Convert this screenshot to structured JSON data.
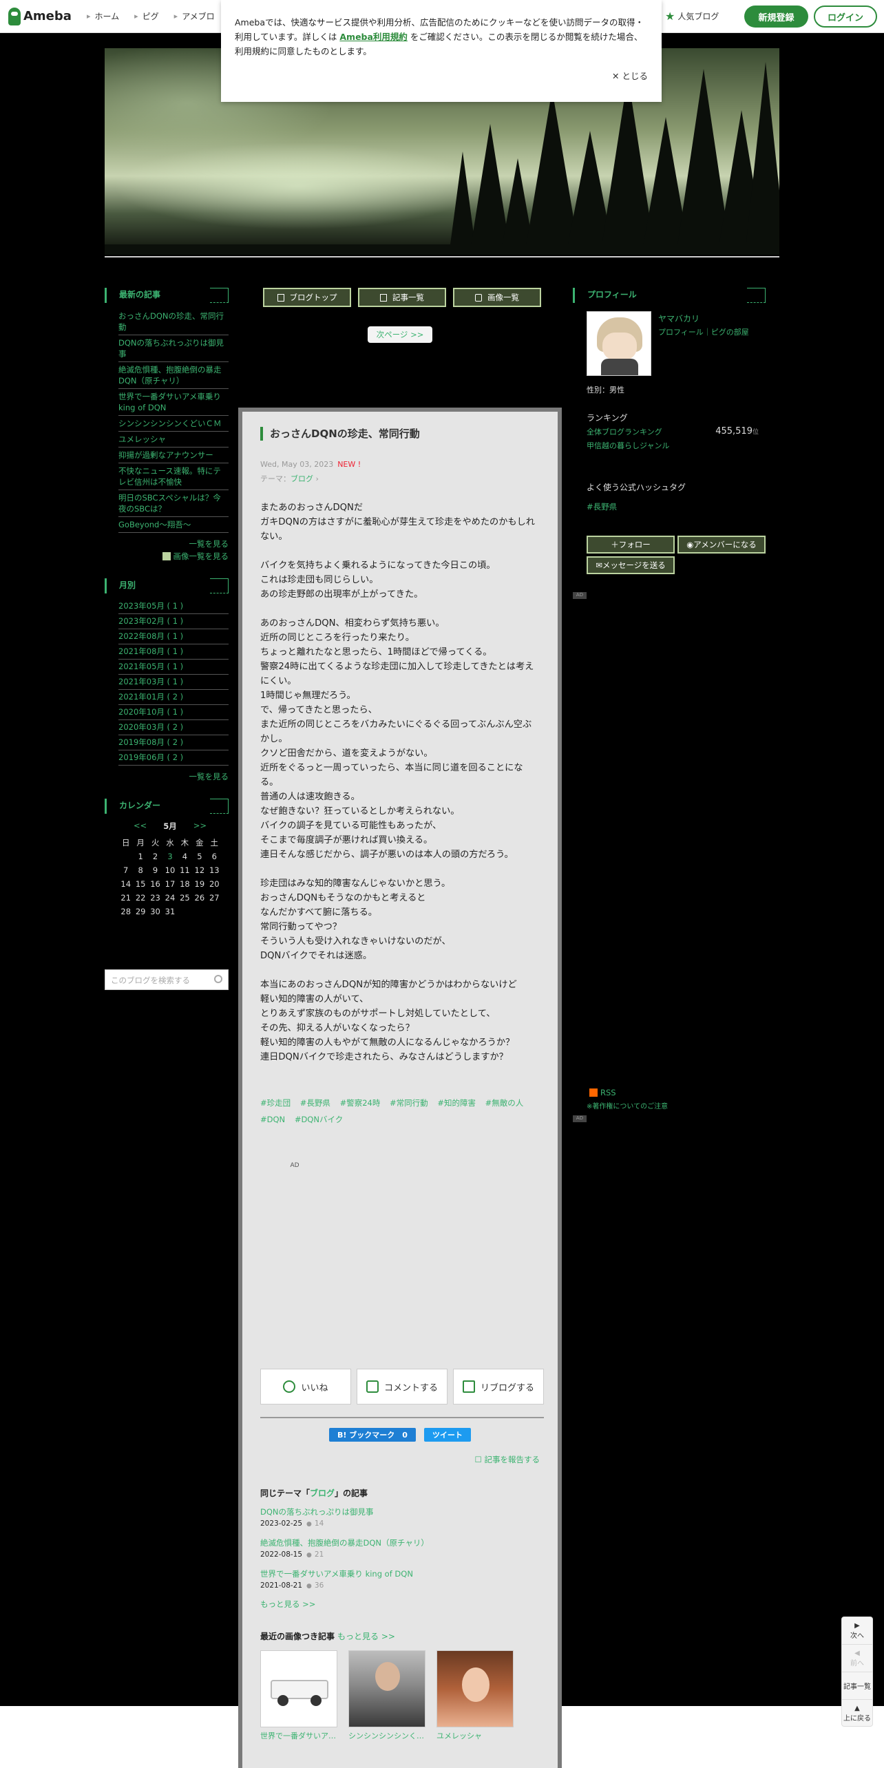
{
  "topbar": {
    "logo": "Ameba",
    "nav": [
      "ホーム",
      "ピグ",
      "アメブロ"
    ],
    "popular": "人気ブログ",
    "register": "新規登録",
    "login": "ログイン"
  },
  "cookie": {
    "text_before": "Amebaでは、快適なサービス提供や利用分析、広告配信のためにクッキーなどを使い訪問データの取得・利用しています。詳しくは",
    "link": "Ameba利用規約",
    "text_after": "をご確認ください。この表示を閉じるか閲覧を続けた場合、利用規約に同意したものとします。",
    "close": "とじる"
  },
  "left": {
    "recent_head": "最新の記事",
    "recent_items": [
      "おっさんDQNの珍走、常同行動",
      "DQNの落ちぶれっぷりは御見事",
      "絶滅危惧種、抱腹絶倒の暴走DQN（原チャリ）",
      "世界で一番ダサいアメ車乗り king of DQN",
      "シンシンシンシンくどいＣＭ",
      "ユメレッシャ",
      "抑揚が過剰なアナウンサー",
      "不快なニュース速報。特にテレビ信州は不愉快",
      "明日のSBCスペシャルは？今夜のSBCは？",
      "GoBeyond～翔吾～"
    ],
    "list_more": "一覧を見る",
    "image_more": "画像一覧を見る",
    "monthly_head": "月別",
    "months": [
      "2023年05月 ( 1 )",
      "2023年02月 ( 1 )",
      "2022年08月 ( 1 )",
      "2021年08月 ( 1 )",
      "2021年05月 ( 1 )",
      "2021年03月 ( 1 )",
      "2021年01月 ( 2 )",
      "2020年10月 ( 1 )",
      "2020年03月 ( 2 )",
      "2019年08月 ( 2 )",
      "2019年06月 ( 2 )"
    ],
    "month_more": "一覧を見る",
    "calendar_head": "カレンダー",
    "calendar": {
      "prev": "<<",
      "month": "5月",
      "next": ">>",
      "weekdays": [
        "日",
        "月",
        "火",
        "水",
        "木",
        "金",
        "土"
      ],
      "weeks": [
        [
          "",
          "1",
          "2",
          "3",
          "4",
          "5",
          "6"
        ],
        [
          "7",
          "8",
          "9",
          "10",
          "11",
          "12",
          "13"
        ],
        [
          "14",
          "15",
          "16",
          "17",
          "18",
          "19",
          "20"
        ],
        [
          "21",
          "22",
          "23",
          "24",
          "25",
          "26",
          "27"
        ],
        [
          "28",
          "29",
          "30",
          "31",
          "",
          "",
          ""
        ]
      ],
      "highlight": "3"
    },
    "search_placeholder": "このブログを検索する"
  },
  "center": {
    "nav": [
      "ブログトップ",
      "記事一覧",
      "画像一覧"
    ],
    "next": "次ページ >>",
    "article": {
      "title": "おっさんDQNの珍走、常同行動",
      "date": "Wed, May 03, 2023",
      "new": "NEW !",
      "theme_label": "テーマ：",
      "theme": "ブログ",
      "body": "またあのおっさんDQNだ\nガキDQNの方はさすがに羞恥心が芽生えて珍走をやめたのかもしれない。\n\nバイクを気持ちよく乗れるようになってきた今日この頃。\nこれは珍走団も同じらしい。\nあの珍走野郎の出現率が上がってきた。\n\nあのおっさんDQN、相変わらず気持ち悪い。\n近所の同じところを行ったり来たり。\nちょっと離れたなと思ったら、1時間ほどで帰ってくる。\n警察24時に出てくるような珍走団に加入して珍走してきたとは考えにくい。\n1時間じゃ無理だろう。\nで、帰ってきたと思ったら、\nまた近所の同じところをバカみたいにぐるぐる回ってぶんぶん空ぶかし。\nクソど田舎だから、道を変えようがない。\n近所をぐるっと一周っていったら、本当に同じ道を回ることになる。\n普通の人は速攻飽きる。\nなぜ飽きない？狂っているとしか考えられない。\nバイクの調子を見ている可能性もあったが、\nそこまで毎度調子が悪ければ買い換える。\n連日そんな感じだから、調子が悪いのは本人の頭の方だろう。\n\n珍走団はみな知的障害なんじゃないかと思う。\nおっさんDQNもそうなのかもと考えると\nなんだかすべて腑に落ちる。\n常同行動ってやつ？\nそういう人も受け入れなきゃいけないのだが、\nDQNバイクでそれは迷惑。\n\n本当にあのおっさんDQNが知的障害かどうかはわからないけど\n軽い知的障害の人がいて、\nとりあえず家族のものがサポートし対処していたとして、\nその先、抑える人がいなくなったら？\n軽い知的障害の人もやがて無敵の人になるんじゃなかろうか？\n連日DQNバイクで珍走されたら、みなさんはどうしますか？",
      "hashtags": [
        "#珍走団",
        "#長野県",
        "#警察24時",
        "#常同行動",
        "#知的障害",
        "#無敵の人",
        "#DQN",
        "#DQNバイク"
      ],
      "ad": "AD"
    },
    "actions": {
      "like": "いいね",
      "comment": "コメントする",
      "reblog": "リブログする"
    },
    "share": {
      "hatena": "B! ブックマーク　0",
      "tweet": "ツイート"
    },
    "report": "記事を報告する",
    "same_theme": {
      "head_prefix": "同じテーマ「",
      "theme": "ブログ",
      "head_suffix": "」の記事",
      "items": [
        {
          "title": "DQNの落ちぶれっぷりは御見事",
          "date": "2023-02-25",
          "count": "14"
        },
        {
          "title": "絶滅危惧種、抱腹絶倒の暴走DQN（原チャリ）",
          "date": "2022-08-15",
          "count": "21"
        },
        {
          "title": "世界で一番ダサいアメ車乗り king of DQN",
          "date": "2021-08-21",
          "count": "36"
        }
      ],
      "more": "もっと見る >>"
    },
    "recent_images": {
      "head": "最近の画像つき記事",
      "more": "もっと見る >>",
      "items": [
        {
          "caption": "世界で一番ダサいア…"
        },
        {
          "caption": "シンシンシンシンく…"
        },
        {
          "caption": "ユメレッシャ"
        }
      ]
    }
  },
  "right": {
    "profile_head": "プロフィール",
    "name": "ヤマバカリ",
    "links": "プロフィール｜ピグの部屋",
    "gender": "性別：男性",
    "ranking_head": "ランキング",
    "ranking_label": "全体ブログランキング",
    "ranking_value": "455,519",
    "ranking_unit": "位",
    "genre": "甲信越の暮らしジャンル",
    "hashtag_head": "よく使う公式ハッシュタグ",
    "hashtag": "#長野県",
    "follow": "フォロー",
    "member": "アメンバーになる",
    "message": "メッセージを送る",
    "rss": "RSS",
    "rss_note": "※著作権についてのご注意",
    "ad": "AD"
  },
  "pager": {
    "next": "次へ",
    "prev": "前へ",
    "list": "記事一覧",
    "top": "上に戻る"
  }
}
